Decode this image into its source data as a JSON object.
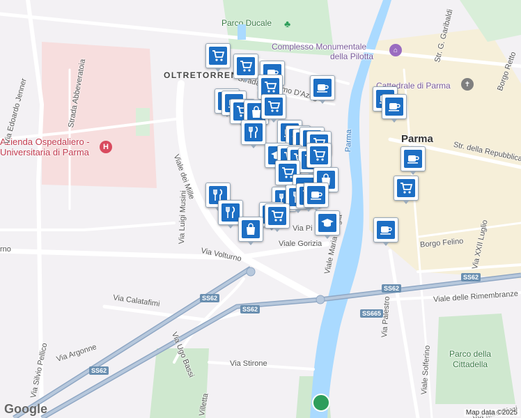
{
  "map": {
    "labels": {
      "parco_ducale": "Parco Ducale",
      "complesso": "Complesso Monumentale",
      "pilotta": "della Pilotta",
      "oltretorrente": "OLTRETORRENTE",
      "cattedrale": "Cattedrale di Parma",
      "parma": "Parma",
      "azienda1": "Azienda Ospedaliero -",
      "azienda2": "Universitaria di Parma",
      "strada_abbeveratoia": "Strada Abbeveratoia",
      "via_jenner": "Via Edoardo Jenner",
      "viale_mille": "Viale dei Mille",
      "via_musini": "Via Luigi Musini",
      "via_volturno": "Via Volturno",
      "viale_gorizia": "Viale Gorizia",
      "via_calatafimi": "Via Calatafimi",
      "via_ugo_bassi": "Via Ugo Bassi",
      "via_argonne": "Via Argonne",
      "via_silvio_pellico": "Via Silvio Pellico",
      "via_stirone": "Via Stirone",
      "villetta": "Villetta",
      "via_palestro": "Via Palestro",
      "viale_solferino": "Viale Solferino",
      "viale_rimembranze": "Viale delle Rimembranze",
      "parco_cittadella1": "Parco della",
      "parco_cittadella2": "Cittadella",
      "via_italo_pizzi": "Via Italo Pizzi",
      "borgo_felino": "Borgo Felino",
      "via_xxii_luglio": "Via XXII Luglio",
      "str_repubblica": "Str. della Repubblica",
      "str_garibaldi": "Str. G. Garibaldi",
      "borgo_retto": "Borgo Retto",
      "strada_azeglio": "Strada Massimo D'Azeglio",
      "parma_river": "Parma",
      "via_maria_luigia": "Viale Maria Luigia",
      "via_pi": "Via Pi",
      "rno": "rno",
      "via_nino": "Via"
    },
    "shields": [
      "SS62",
      "SS62",
      "SS62",
      "SS665",
      "SS62"
    ],
    "footer": "Map data ©2025",
    "logo": "Google"
  }
}
